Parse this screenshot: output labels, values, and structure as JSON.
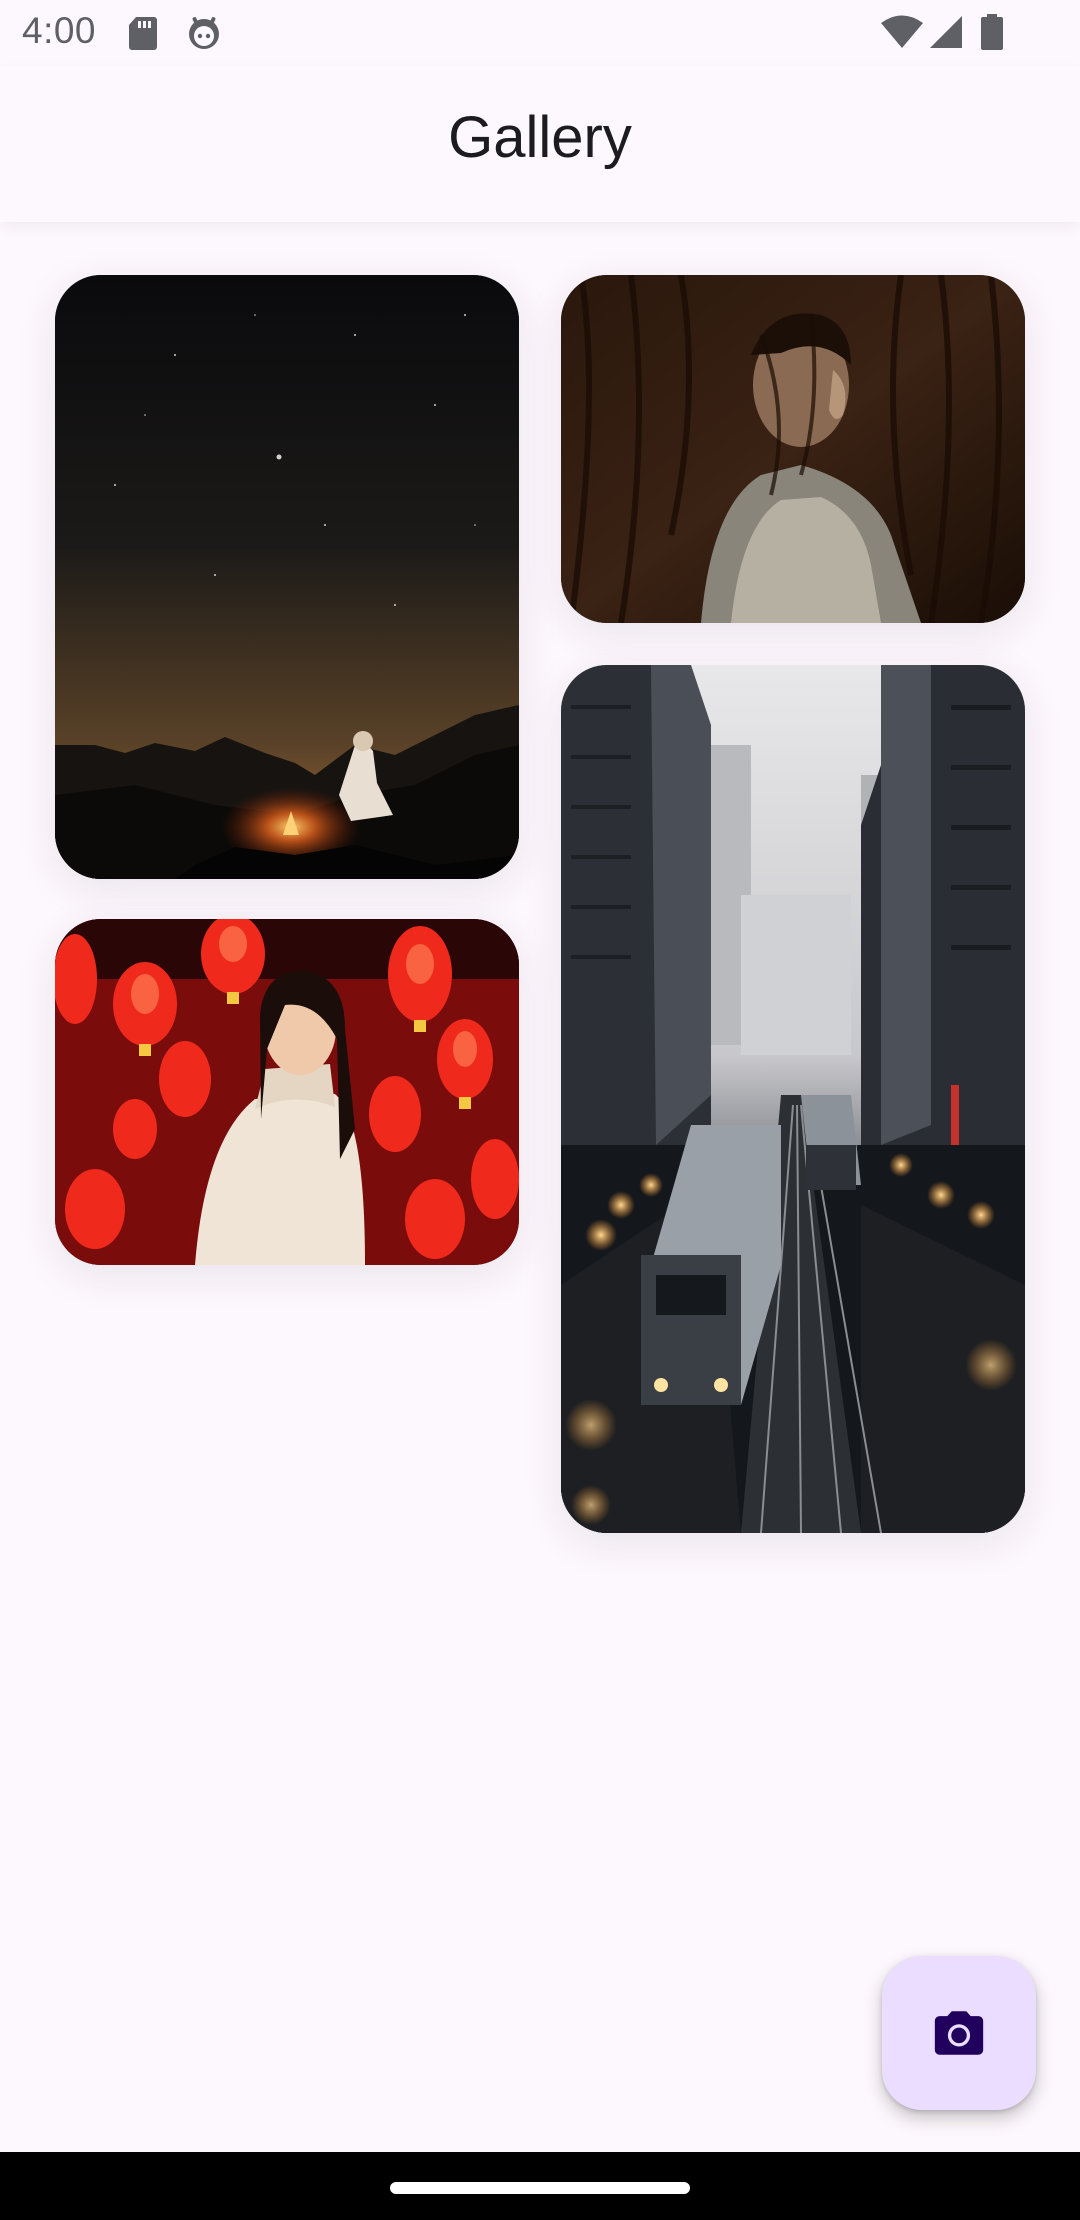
{
  "status_bar": {
    "time": "4:00",
    "icons": [
      "sd-card-icon",
      "android-debug-icon",
      "wifi-icon",
      "cell-signal-icon",
      "battery-icon"
    ]
  },
  "app_bar": {
    "title": "Gallery"
  },
  "gallery": {
    "photos": [
      {
        "name": "photo-night-sky-campfire",
        "column": 1
      },
      {
        "name": "photo-portrait-shadows",
        "column": 2
      },
      {
        "name": "photo-red-lanterns",
        "column": 1
      },
      {
        "name": "photo-city-train",
        "column": 2
      }
    ]
  },
  "fab": {
    "icon": "camera-icon"
  },
  "colors": {
    "background": "#fdf8fd",
    "title": "#1c1b1f",
    "fab_container": "#eaddff",
    "fab_icon": "#21005d",
    "nav_bar": "#000000"
  }
}
